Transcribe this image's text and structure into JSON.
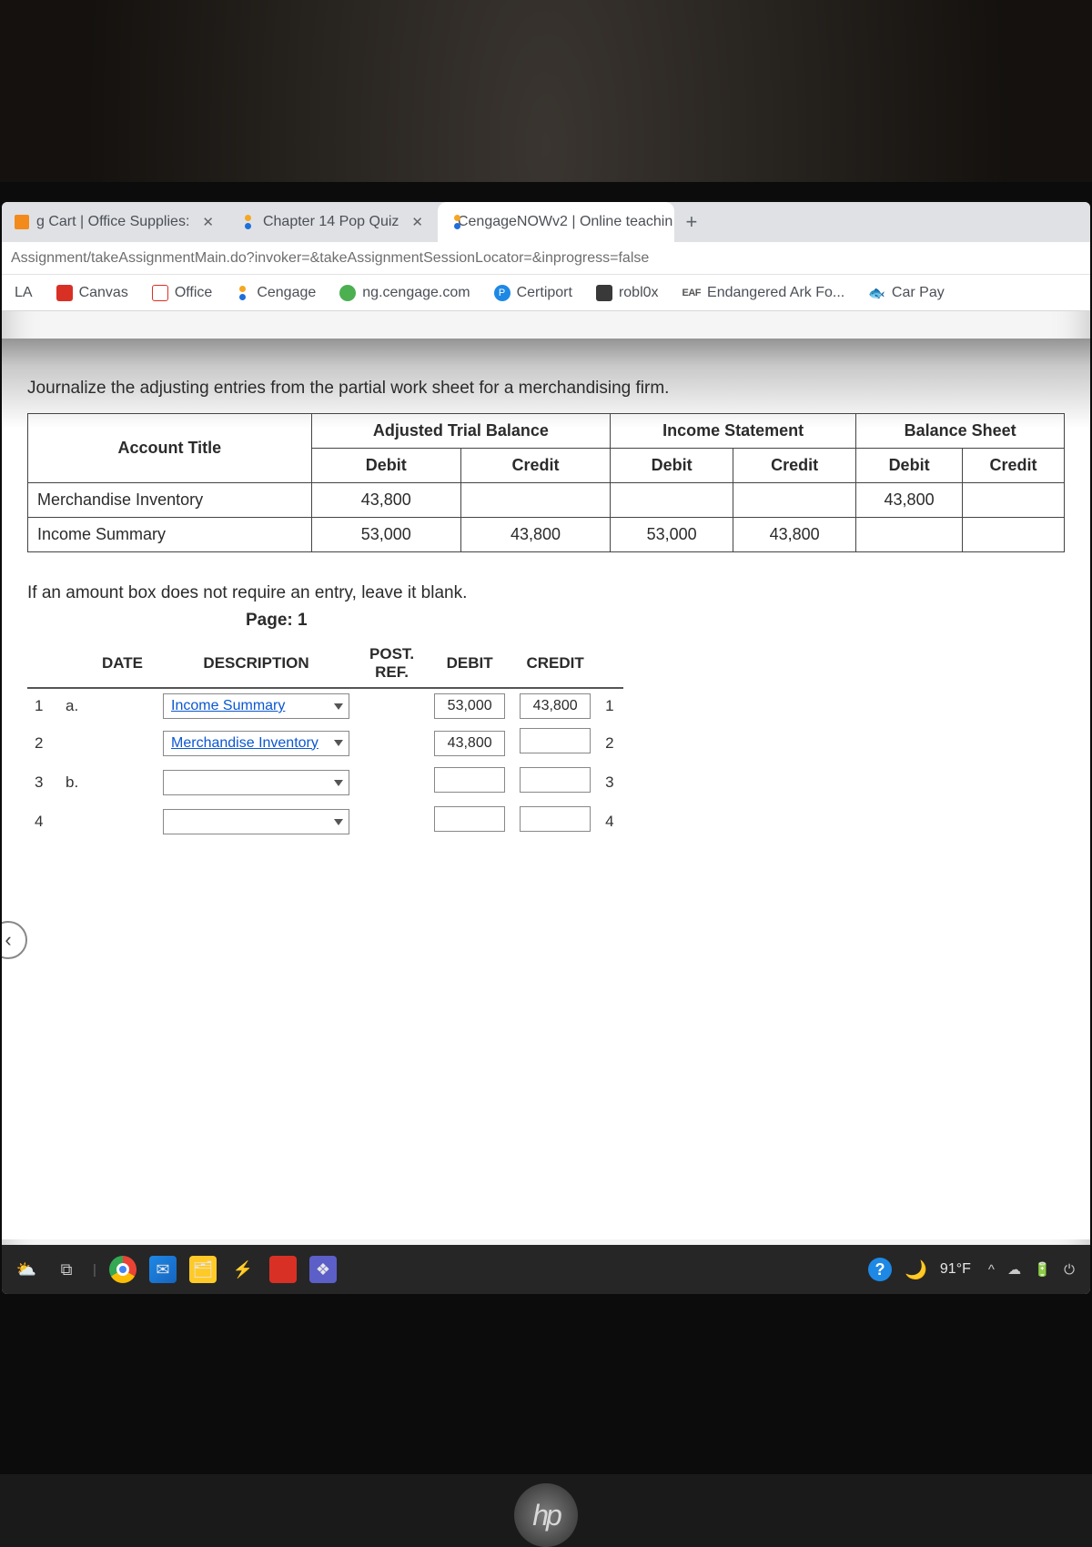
{
  "tabs": [
    {
      "title": "g Cart | Office Supplies:"
    },
    {
      "title": "Chapter 14 Pop Quiz"
    },
    {
      "title": "CengageNOWv2 | Online teachin"
    }
  ],
  "url": "Assignment/takeAssignmentMain.do?invoker=&takeAssignmentSessionLocator=&inprogress=false",
  "bookmarks": {
    "la": "LA",
    "canvas": "Canvas",
    "office": "Office",
    "cengage": "Cengage",
    "ng": "ng.cengage.com",
    "certiport": "Certiport",
    "roblox": "robl0x",
    "eaf_prefix": "EAF",
    "eaf": "Endangered Ark Fo...",
    "carpay": "Car Pay"
  },
  "instruction": "Journalize the adjusting entries from the partial work sheet for a merchandising firm.",
  "worksheet": {
    "headers": {
      "account": "Account Title",
      "atb": "Adjusted Trial Balance",
      "is": "Income Statement",
      "bs": "Balance Sheet",
      "debit": "Debit",
      "credit": "Credit"
    },
    "rows": [
      {
        "account": "Merchandise Inventory",
        "atb_d": "43,800",
        "atb_c": "",
        "is_d": "",
        "is_c": "",
        "bs_d": "43,800",
        "bs_c": ""
      },
      {
        "account": "Income Summary",
        "atb_d": "53,000",
        "atb_c": "43,800",
        "is_d": "53,000",
        "is_c": "43,800",
        "bs_d": "",
        "bs_c": ""
      }
    ]
  },
  "note": "If an amount box does not require an entry, leave it blank.",
  "page_label": "Page: 1",
  "journal": {
    "headers": {
      "date": "DATE",
      "desc": "DESCRIPTION",
      "post": "POST.",
      "ref": "REF.",
      "debit": "DEBIT",
      "credit": "CREDIT"
    },
    "rows": [
      {
        "n": "1",
        "label": "a.",
        "desc": "Income Summary",
        "debit": "53,000",
        "credit": "43,800",
        "rn": "1"
      },
      {
        "n": "2",
        "label": "",
        "desc": "Merchandise Inventory",
        "debit": "43,800",
        "credit": "",
        "rn": "2"
      },
      {
        "n": "3",
        "label": "b.",
        "desc": "",
        "debit": "",
        "credit": "",
        "rn": "3"
      },
      {
        "n": "4",
        "label": "",
        "desc": "",
        "debit": "",
        "credit": "",
        "rn": "4"
      }
    ]
  },
  "taskbar": {
    "temp": "91°F"
  }
}
